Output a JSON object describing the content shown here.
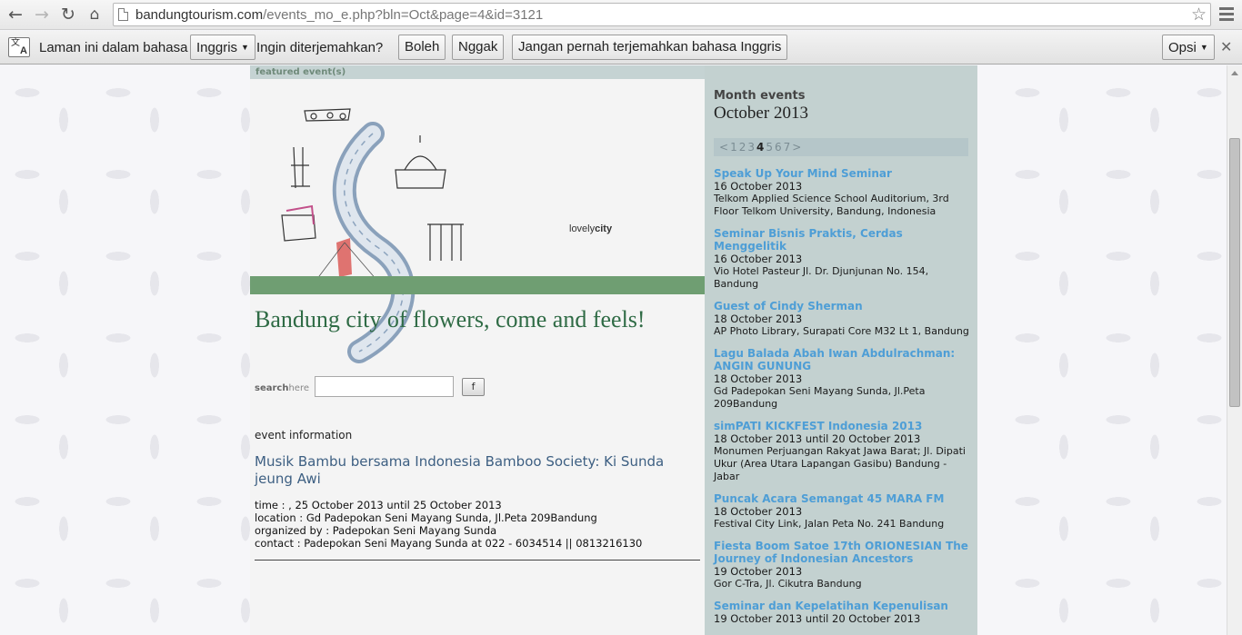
{
  "browser": {
    "url_host": "bandungtourism.com",
    "url_rest": "/events_mo_e.php?bln=Oct&page=4&id=3121"
  },
  "infobar": {
    "prefix": "Laman ini dalam bahasa",
    "language": "Inggris",
    "question": "Ingin diterjemahkan?",
    "yes": "Boleh",
    "no": "Nggak",
    "never": "Jangan pernah terjemahkan bahasa Inggris",
    "options": "Opsi"
  },
  "main": {
    "featured_label": "featured event(s)",
    "banner_text_light": "lovely",
    "banner_text_bold": "city",
    "tagline": "Bandung city of flowers, come and feels!",
    "search_bold": "search",
    "search_rest": "here",
    "search_button": "f",
    "event_info_label": "event information",
    "event_title": "Musik Bambu bersama Indonesia Bamboo Society: Ki Sunda jeung Awi",
    "details": {
      "time": "time : , 25 October 2013 until 25 October 2013",
      "location": "location : Gd Padepokan Seni Mayang Sunda, Jl.Peta 209Bandung",
      "organizer": "organized by : Padepokan Seni Mayang Sunda",
      "contact": "contact : Padepokan Seni Mayang Sunda at 022 - 6034514 || 0813216130"
    }
  },
  "sidebar": {
    "heading": "Month events",
    "month": "October 2013",
    "pager": [
      "<",
      "1",
      "2",
      "3",
      "4",
      "5",
      "6",
      "7",
      ">"
    ],
    "current_page": "4",
    "events": [
      {
        "name": "Speak Up Your Mind Seminar",
        "date": "16 October 2013",
        "place": "Telkom Applied Science School Auditorium, 3rd Floor Telkom University, Bandung, Indonesia"
      },
      {
        "name": "Seminar Bisnis Praktis, Cerdas Menggelitik",
        "date": "16 October 2013",
        "place": "Vio Hotel Pasteur Jl. Dr. Djunjunan No. 154, Bandung"
      },
      {
        "name": "Guest of Cindy Sherman",
        "date": "18 October 2013",
        "place": "AP Photo Library, Surapati Core M32 Lt 1, Bandung"
      },
      {
        "name": "Lagu Balada Abah Iwan Abdulrachman: ANGIN GUNUNG",
        "date": "18 October 2013",
        "place": "Gd Padepokan Seni Mayang Sunda, Jl.Peta 209Bandung"
      },
      {
        "name": "simPATI KICKFEST Indonesia 2013",
        "date": "18 October 2013 until 20 October 2013",
        "place": "Monumen Perjuangan Rakyat Jawa Barat; Jl. Dipati Ukur (Area Utara Lapangan Gasibu) Bandung - Jabar"
      },
      {
        "name": "Puncak Acara Semangat 45 MARA FM",
        "date": "18 October 2013",
        "place": "Festival City Link, Jalan Peta No. 241 Bandung"
      },
      {
        "name": "Fiesta Boom Satoe 17th ORIONESIAN The Journey of Indonesian Ancestors",
        "date": "19 October 2013",
        "place": "Gor C-Tra, Jl. Cikutra Bandung"
      },
      {
        "name": "Seminar dan Kepelatihan Kepenulisan",
        "date": "19 October 2013 until 20 October 2013",
        "place": ""
      }
    ]
  }
}
